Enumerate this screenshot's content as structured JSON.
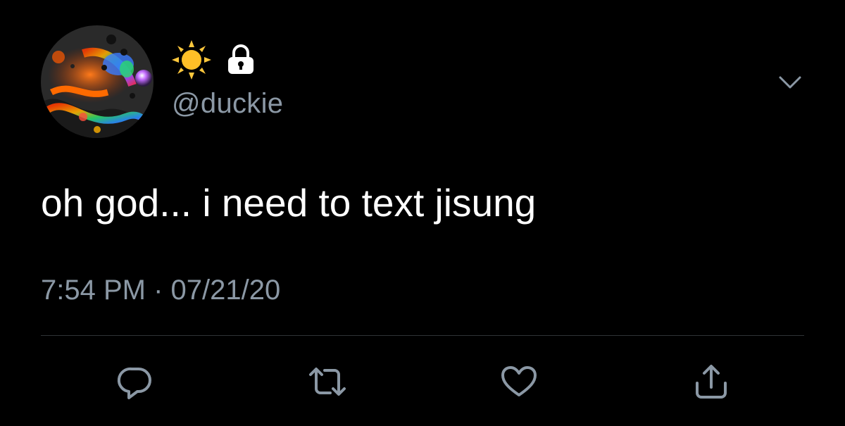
{
  "user": {
    "name_emoji": "sun-emoji",
    "protected_icon": "lock-icon",
    "handle": "@duckie",
    "avatar": "avatar-colorful-abstract-oil-slick"
  },
  "tweet": {
    "text": "oh god... i need to text jisung",
    "time": "7:54 PM",
    "separator": "·",
    "date": "07/21/20"
  },
  "actions": [
    {
      "name": "reply",
      "icon": "reply-icon"
    },
    {
      "name": "retweet",
      "icon": "retweet-icon"
    },
    {
      "name": "like",
      "icon": "heart-icon"
    },
    {
      "name": "share",
      "icon": "share-icon"
    }
  ],
  "menu": {
    "icon": "chevron-down-icon"
  },
  "colors": {
    "background": "#000000",
    "primary_text": "#ffffff",
    "secondary_text": "#8b98a5",
    "divider": "#2f3336",
    "sun": "#ffc83d"
  }
}
